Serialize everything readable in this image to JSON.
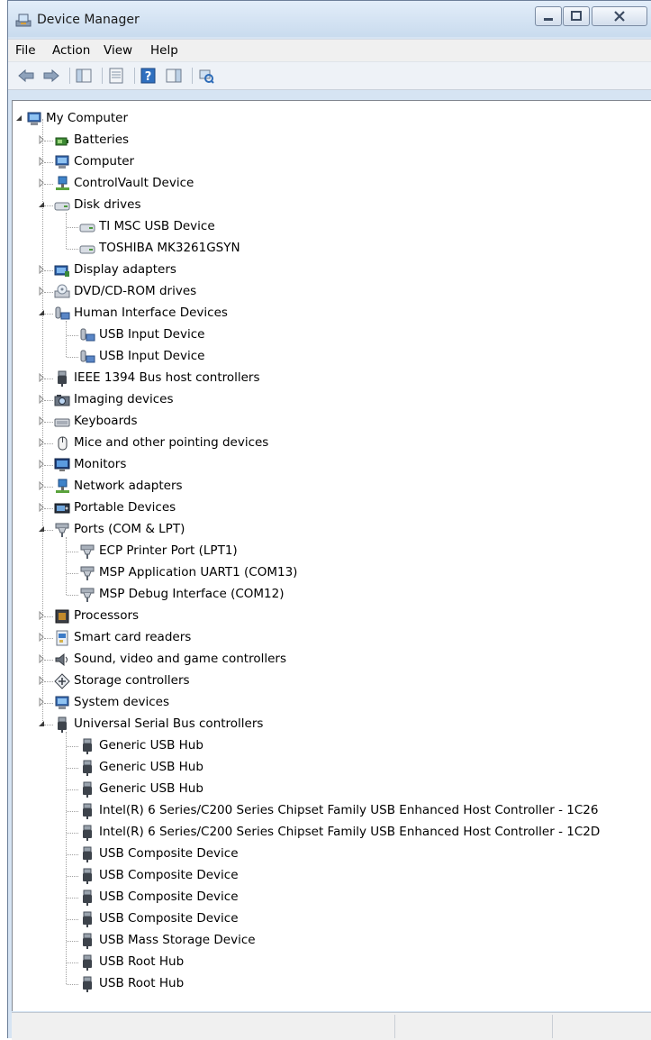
{
  "window": {
    "title": "Device Manager"
  },
  "menu": [
    "File",
    "Action",
    "View",
    "Help"
  ],
  "toolbar": [
    "back-arrow-icon",
    "forward-arrow-icon",
    "sep",
    "show-hide-console-tree-icon",
    "sep",
    "properties-icon",
    "sep",
    "help-icon",
    "action-pane-icon",
    "sep",
    "scan-hardware-changes-icon"
  ],
  "tree": [
    {
      "label": "My Computer",
      "level": 0,
      "expand": "open",
      "icon": "computer-icon"
    },
    {
      "label": "Batteries",
      "level": 1,
      "expand": "closed",
      "icon": "battery-icon"
    },
    {
      "label": "Computer",
      "level": 1,
      "expand": "closed",
      "icon": "computer-icon"
    },
    {
      "label": "ControlVault Device",
      "level": 1,
      "expand": "closed",
      "icon": "network-device-icon"
    },
    {
      "label": "Disk drives",
      "level": 1,
      "expand": "open",
      "icon": "disk-drive-icon"
    },
    {
      "label": "TI MSC USB Device",
      "level": 2,
      "expand": "none",
      "icon": "disk-drive-icon"
    },
    {
      "label": "TOSHIBA MK3261GSYN",
      "level": 2,
      "expand": "none",
      "icon": "disk-drive-icon"
    },
    {
      "label": "Display adapters",
      "level": 1,
      "expand": "closed",
      "icon": "display-adapter-icon"
    },
    {
      "label": "DVD/CD-ROM drives",
      "level": 1,
      "expand": "closed",
      "icon": "dvd-drive-icon"
    },
    {
      "label": "Human Interface Devices",
      "level": 1,
      "expand": "open",
      "icon": "hid-icon"
    },
    {
      "label": "USB Input Device",
      "level": 2,
      "expand": "none",
      "icon": "hid-icon"
    },
    {
      "label": "USB Input Device",
      "level": 2,
      "expand": "none",
      "icon": "hid-icon"
    },
    {
      "label": "IEEE 1394 Bus host controllers",
      "level": 1,
      "expand": "closed",
      "icon": "usb-plug-icon"
    },
    {
      "label": "Imaging devices",
      "level": 1,
      "expand": "closed",
      "icon": "camera-icon"
    },
    {
      "label": "Keyboards",
      "level": 1,
      "expand": "closed",
      "icon": "keyboard-icon"
    },
    {
      "label": "Mice and other pointing devices",
      "level": 1,
      "expand": "closed",
      "icon": "mouse-icon"
    },
    {
      "label": "Monitors",
      "level": 1,
      "expand": "closed",
      "icon": "monitor-icon"
    },
    {
      "label": "Network adapters",
      "level": 1,
      "expand": "closed",
      "icon": "network-device-icon"
    },
    {
      "label": "Portable Devices",
      "level": 1,
      "expand": "closed",
      "icon": "portable-device-icon"
    },
    {
      "label": "Ports (COM & LPT)",
      "level": 1,
      "expand": "open",
      "icon": "port-icon"
    },
    {
      "label": "ECP Printer Port (LPT1)",
      "level": 2,
      "expand": "none",
      "icon": "port-icon"
    },
    {
      "label": "MSP Application UART1 (COM13)",
      "level": 2,
      "expand": "none",
      "icon": "port-icon"
    },
    {
      "label": "MSP Debug Interface (COM12)",
      "level": 2,
      "expand": "none",
      "icon": "port-icon"
    },
    {
      "label": "Processors",
      "level": 1,
      "expand": "closed",
      "icon": "processor-icon"
    },
    {
      "label": "Smart card readers",
      "level": 1,
      "expand": "closed",
      "icon": "smart-card-icon"
    },
    {
      "label": "Sound, video and game controllers",
      "level": 1,
      "expand": "closed",
      "icon": "speaker-icon"
    },
    {
      "label": "Storage controllers",
      "level": 1,
      "expand": "closed",
      "icon": "storage-controller-icon"
    },
    {
      "label": "System devices",
      "level": 1,
      "expand": "closed",
      "icon": "computer-icon"
    },
    {
      "label": "Universal Serial Bus controllers",
      "level": 1,
      "expand": "open",
      "icon": "usb-plug-icon"
    },
    {
      "label": "Generic USB Hub",
      "level": 2,
      "expand": "none",
      "icon": "usb-plug-icon"
    },
    {
      "label": "Generic USB Hub",
      "level": 2,
      "expand": "none",
      "icon": "usb-plug-icon"
    },
    {
      "label": "Generic USB Hub",
      "level": 2,
      "expand": "none",
      "icon": "usb-plug-icon"
    },
    {
      "label": "Intel(R) 6 Series/C200 Series Chipset Family USB Enhanced Host Controller - 1C26",
      "level": 2,
      "expand": "none",
      "icon": "usb-plug-icon"
    },
    {
      "label": "Intel(R) 6 Series/C200 Series Chipset Family USB Enhanced Host Controller - 1C2D",
      "level": 2,
      "expand": "none",
      "icon": "usb-plug-icon"
    },
    {
      "label": "USB Composite Device",
      "level": 2,
      "expand": "none",
      "icon": "usb-plug-icon"
    },
    {
      "label": "USB Composite Device",
      "level": 2,
      "expand": "none",
      "icon": "usb-plug-icon"
    },
    {
      "label": "USB Composite Device",
      "level": 2,
      "expand": "none",
      "icon": "usb-plug-icon"
    },
    {
      "label": "USB Composite Device",
      "level": 2,
      "expand": "none",
      "icon": "usb-plug-icon"
    },
    {
      "label": "USB Mass Storage Device",
      "level": 2,
      "expand": "none",
      "icon": "usb-plug-icon"
    },
    {
      "label": "USB Root Hub",
      "level": 2,
      "expand": "none",
      "icon": "usb-plug-icon"
    },
    {
      "label": "USB Root Hub",
      "level": 2,
      "expand": "none",
      "icon": "usb-plug-icon"
    }
  ]
}
